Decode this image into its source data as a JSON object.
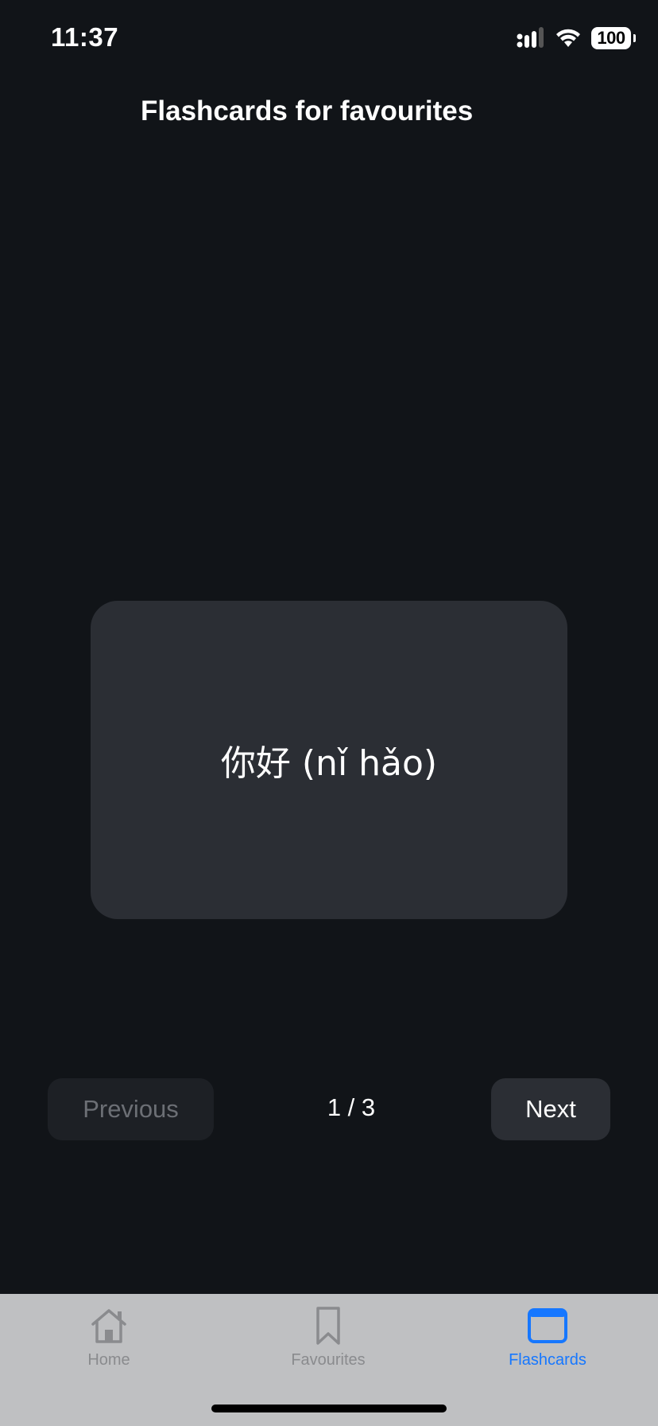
{
  "status_bar": {
    "time": "11:37",
    "battery": "100",
    "icons": [
      "signal-icon",
      "wifi-icon",
      "battery-icon"
    ]
  },
  "header": {
    "title": "Flashcards for favourites"
  },
  "flashcard": {
    "text": "你好 (nǐ hǎo)"
  },
  "controls": {
    "previous_label": "Previous",
    "next_label": "Next",
    "counter": "1 / 3"
  },
  "tabbar": {
    "tabs": [
      {
        "label": "Home",
        "icon": "home-icon",
        "active": false
      },
      {
        "label": "Favourites",
        "icon": "bookmark-icon",
        "active": false
      },
      {
        "label": "Flashcards",
        "icon": "flashcards-icon",
        "active": true
      }
    ]
  },
  "colors": {
    "background": "#111418",
    "card": "#2b2e34",
    "accent": "#1677ff",
    "tabbar": "#bfc0c2"
  }
}
